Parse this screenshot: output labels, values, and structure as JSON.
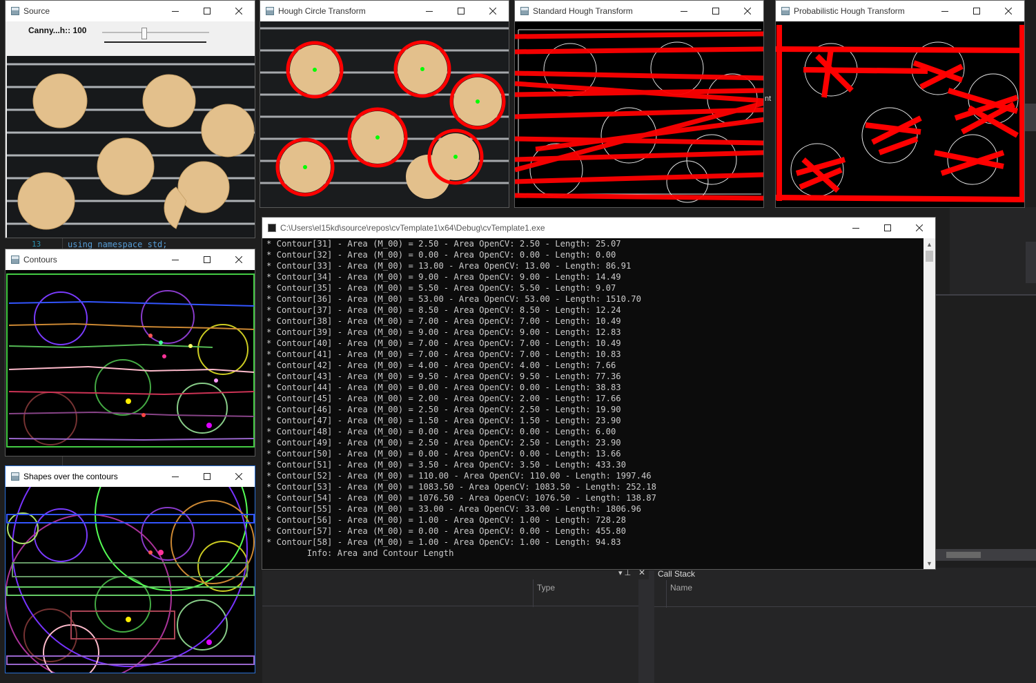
{
  "ide": {
    "code_line_number": "13",
    "code_line": "using namespace std;",
    "obscured_code_fragment": "nt",
    "type_column": "Type",
    "call_stack_title": "Call Stack",
    "name_column": "Name"
  },
  "windows": {
    "source": {
      "title": "Source",
      "trackbar_label": "Canny...h:: 100",
      "trackbar_value": 0.39
    },
    "hough_circle": {
      "title": "Hough Circle Transform"
    },
    "standard_hough": {
      "title": "Standard Hough Transform"
    },
    "probabilistic_hough": {
      "title": "Probabilistic Hough Transform"
    },
    "contours": {
      "title": "Contours"
    },
    "shapes": {
      "title": "Shapes over the contours"
    },
    "console": {
      "title": "C:\\Users\\el15kd\\source\\repos\\cvTemplate1\\x64\\Debug\\cvTemplate1.exe",
      "lines": [
        "* Contour[31] - Area (M_00) = 2.50 - Area OpenCV: 2.50 - Length: 25.07",
        "* Contour[32] - Area (M_00) = 0.00 - Area OpenCV: 0.00 - Length: 0.00",
        "* Contour[33] - Area (M_00) = 13.00 - Area OpenCV: 13.00 - Length: 86.91",
        "* Contour[34] - Area (M_00) = 9.00 - Area OpenCV: 9.00 - Length: 14.49",
        "* Contour[35] - Area (M_00) = 5.50 - Area OpenCV: 5.50 - Length: 9.07",
        "* Contour[36] - Area (M_00) = 53.00 - Area OpenCV: 53.00 - Length: 1510.70",
        "* Contour[37] - Area (M_00) = 8.50 - Area OpenCV: 8.50 - Length: 12.24",
        "* Contour[38] - Area (M_00) = 7.00 - Area OpenCV: 7.00 - Length: 10.49",
        "* Contour[39] - Area (M_00) = 9.00 - Area OpenCV: 9.00 - Length: 12.83",
        "* Contour[40] - Area (M_00) = 7.00 - Area OpenCV: 7.00 - Length: 10.49",
        "* Contour[41] - Area (M_00) = 7.00 - Area OpenCV: 7.00 - Length: 10.83",
        "* Contour[42] - Area (M_00) = 4.00 - Area OpenCV: 4.00 - Length: 7.66",
        "* Contour[43] - Area (M_00) = 9.50 - Area OpenCV: 9.50 - Length: 77.36",
        "* Contour[44] - Area (M_00) = 0.00 - Area OpenCV: 0.00 - Length: 38.83",
        "* Contour[45] - Area (M_00) = 2.00 - Area OpenCV: 2.00 - Length: 17.66",
        "* Contour[46] - Area (M_00) = 2.50 - Area OpenCV: 2.50 - Length: 19.90",
        "* Contour[47] - Area (M_00) = 1.50 - Area OpenCV: 1.50 - Length: 23.90",
        "* Contour[48] - Area (M_00) = 0.00 - Area OpenCV: 0.00 - Length: 6.00",
        "* Contour[49] - Area (M_00) = 2.50 - Area OpenCV: 2.50 - Length: 23.90",
        "* Contour[50] - Area (M_00) = 0.00 - Area OpenCV: 0.00 - Length: 13.66",
        "* Contour[51] - Area (M_00) = 3.50 - Area OpenCV: 3.50 - Length: 433.30",
        "* Contour[52] - Area (M_00) = 110.00 - Area OpenCV: 110.00 - Length: 1997.46",
        "* Contour[53] - Area (M_00) = 1083.50 - Area OpenCV: 1083.50 - Length: 252.18",
        "* Contour[54] - Area (M_00) = 1076.50 - Area OpenCV: 1076.50 - Length: 138.87",
        "* Contour[55] - Area (M_00) = 33.00 - Area OpenCV: 33.00 - Length: 1806.96",
        "* Contour[56] - Area (M_00) = 1.00 - Area OpenCV: 1.00 - Length: 728.28",
        "* Contour[57] - Area (M_00) = 0.00 - Area OpenCV: 0.00 - Length: 455.80",
        "* Contour[58] - Area (M_00) = 1.00 - Area OpenCV: 1.00 - Length: 94.83",
        "        Info: Area and Contour Length"
      ]
    }
  },
  "colors": {
    "hough_red": "#ff0000",
    "circle_center": "#00ff00",
    "console_text": "#cccccc",
    "ide_bg": "#1e1e1e"
  },
  "icons": {
    "window_app": "opencv-window-icon",
    "minimize": "minimize-icon",
    "maximize": "maximize-icon",
    "close": "close-icon"
  }
}
